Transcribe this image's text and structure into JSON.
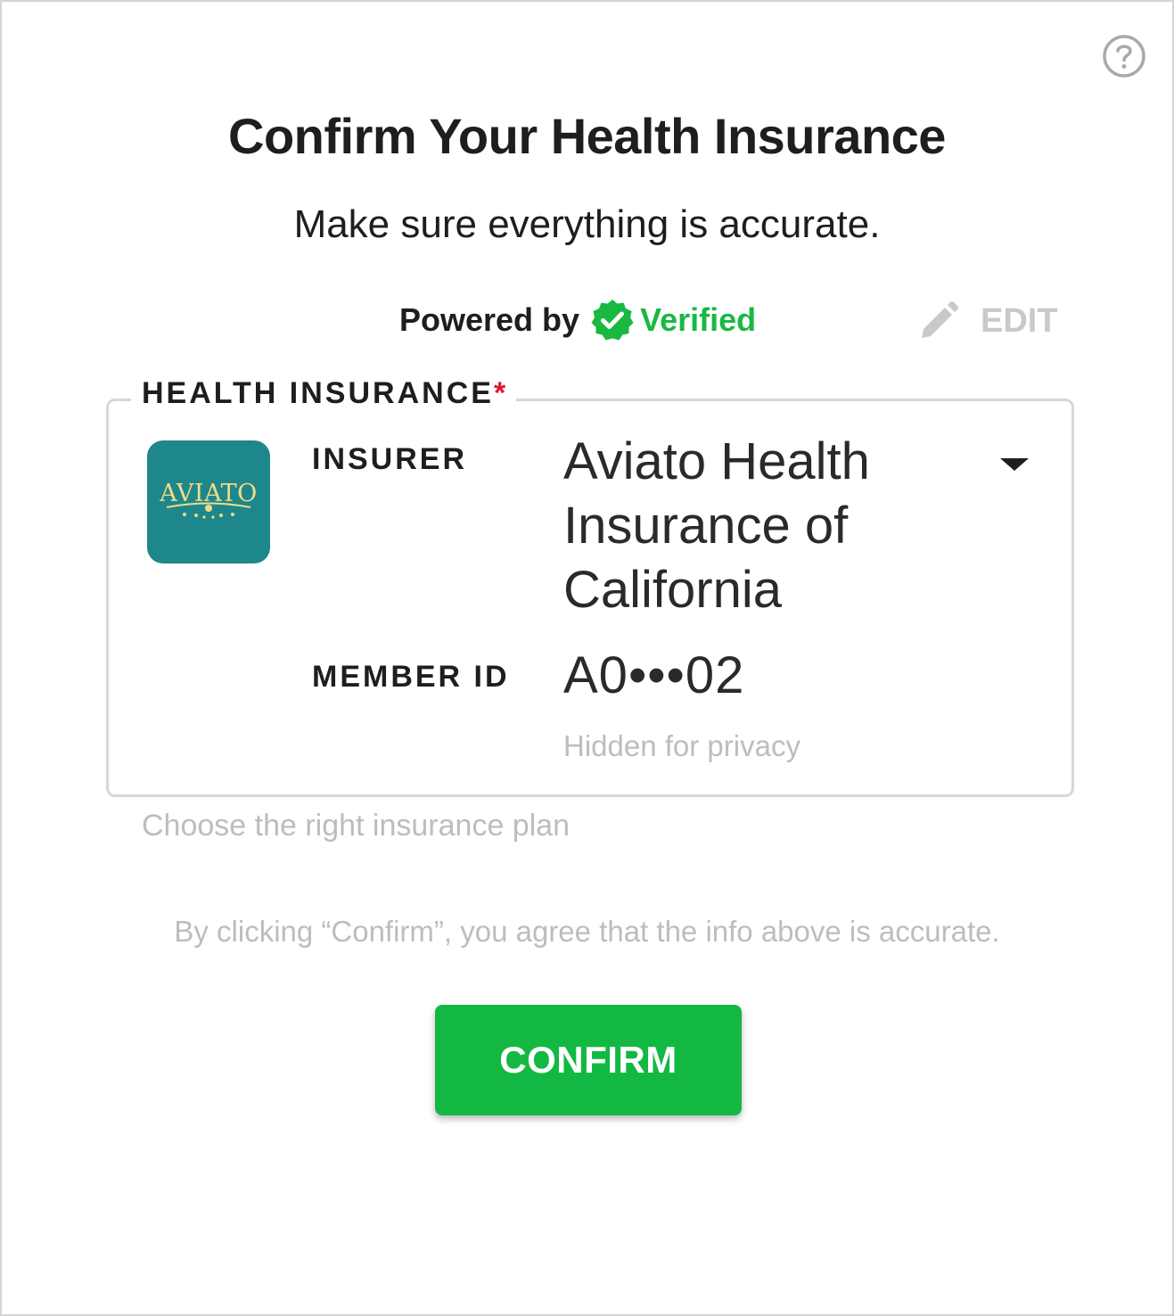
{
  "dialog": {
    "title": "Confirm Your Health Insurance",
    "subtitle": "Make sure everything is accurate.",
    "help_icon": "question-circle-icon"
  },
  "powered_by": {
    "label": "Powered by",
    "brand": "Verified",
    "brand_icon": "verified-check-badge-icon",
    "brand_color": "#19b941"
  },
  "edit": {
    "label": "EDIT",
    "icon": "pencil-icon"
  },
  "health_insurance": {
    "legend": "HEALTH INSURANCE",
    "required_marker": "*",
    "insurer": {
      "label": "INSURER",
      "logo_text": "AVIATO",
      "logo_color": "#1e878b",
      "value": "Aviato Health Insurance of California",
      "dropdown_icon": "caret-down-icon"
    },
    "member_id": {
      "label": "MEMBER ID",
      "value": "A0•••02",
      "hint": "Hidden for privacy"
    }
  },
  "plan_hint": "Choose the right insurance plan",
  "agreement": "By clicking “Confirm”, you agree that the info above is accurate.",
  "confirm": {
    "label": "CONFIRM",
    "color": "#13b843"
  }
}
